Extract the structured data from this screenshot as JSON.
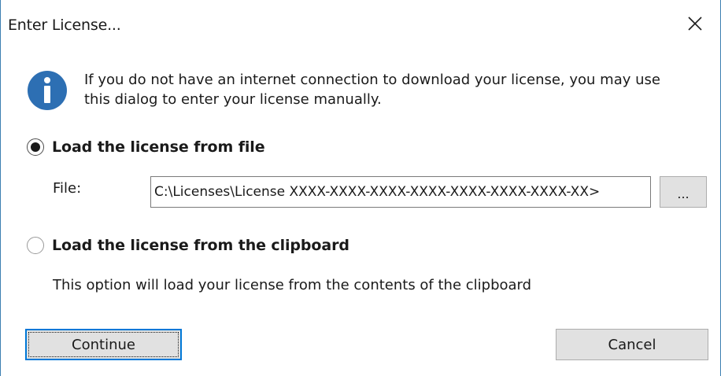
{
  "dialog": {
    "title": "Enter License...",
    "close_icon": "close-icon"
  },
  "info": {
    "icon": "info-icon",
    "icon_color": "#2d6fb3",
    "line1": "If you do not have an internet connection to download your license, you may use",
    "line2": "this dialog to enter your license manually."
  },
  "options": {
    "file": {
      "label": "Load the license from file",
      "selected": true,
      "file_label": "File:",
      "file_value": "C:\\Licenses\\License XXXX-XXXX-XXXX-XXXX-XXXX-XXXX-XXXX-XX>",
      "browse_label": "..."
    },
    "clipboard": {
      "label": "Load the license from the clipboard",
      "selected": false,
      "description": "This option will load your license from the contents of the clipboard"
    }
  },
  "buttons": {
    "continue_label": "Continue",
    "cancel_label": "Cancel"
  },
  "colors": {
    "accent": "#0078d7",
    "window_border": "#3c7fb1",
    "button_face": "#e1e1e1"
  }
}
